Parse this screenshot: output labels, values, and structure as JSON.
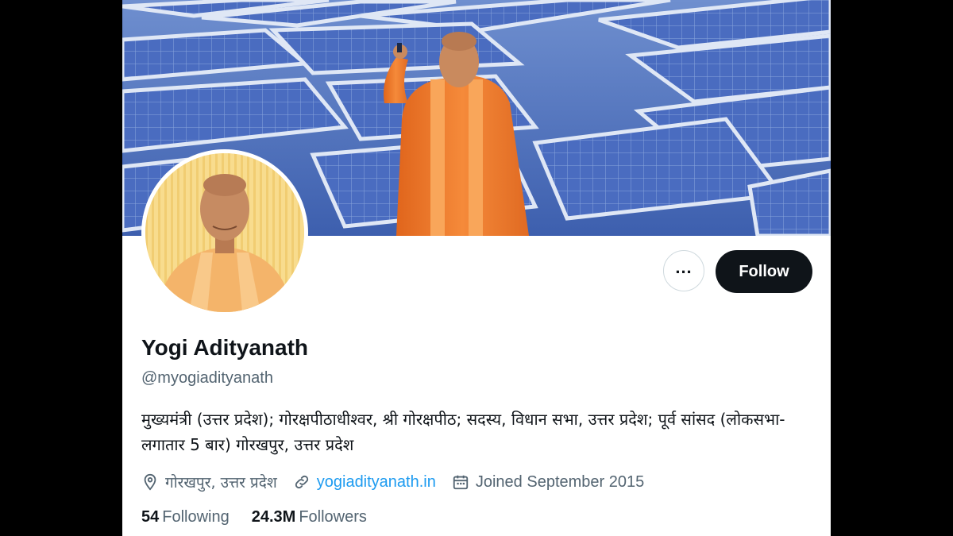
{
  "profile": {
    "name": "Yogi Adityanath",
    "handle": "@myogiadityanath",
    "bio": "मुख्यमंत्री (उत्तर प्रदेश); गोरक्षपीठाधीश्वर, श्री गोरक्षपीठ; सदस्य, विधान सभा, उत्तर प्रदेश; पूर्व सांसद (लोकसभा-लगातार 5 बार) गोरखपुर, उत्तर प्रदेश",
    "location": "गोरखपुर, उत्तर प्रदेश",
    "website": "yogiadityanath.in",
    "joined": "Joined September 2015",
    "following_count": "54",
    "following_label": "Following",
    "followers_count": "24.3M",
    "followers_label": "Followers"
  },
  "actions": {
    "more_icon": "more-horizontal-icon",
    "follow_label": "Follow"
  },
  "colors": {
    "follow_bg": "#0f1419",
    "link": "#1d9bf0",
    "secondary_text": "#536471",
    "banner_sky": "#5d7fc1",
    "robe": "#f07a2a"
  }
}
